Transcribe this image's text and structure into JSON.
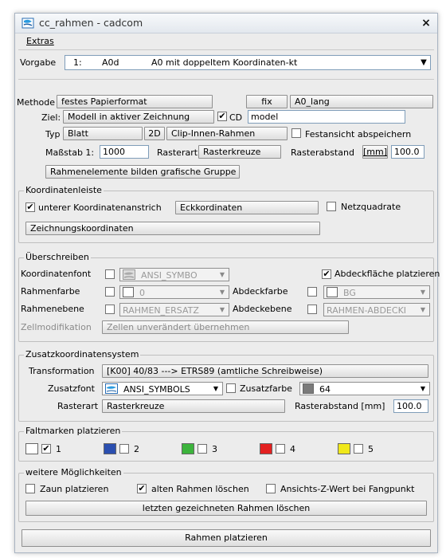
{
  "window": {
    "title": "cc_rahmen - cadcom",
    "close_glyph": "×"
  },
  "menu": {
    "extras": "Extras"
  },
  "vorgabe": {
    "label": "Vorgabe",
    "num": "1:",
    "code": "A0d",
    "desc": "A0 mit doppeltem Koordinaten-kt"
  },
  "methode": {
    "label": "Methode",
    "value": "festes Papierformat",
    "fix": "fix",
    "format": "A0_lang",
    "ziel_label": "Ziel:",
    "ziel_value": "Modell in aktiver Zeichnung",
    "cd_label": "CD",
    "cd_checked": "✔",
    "cd_value": "model",
    "typ_label": "Typ",
    "typ_value": "Blatt",
    "dim": "2D",
    "clip": "Clip-Innen-Rahmen",
    "festansicht_label": "Festansicht abspeichern",
    "massstab_label": "Maßstab 1:",
    "massstab_value": "1000",
    "rasterart_label": "Rasterart",
    "rasterart_value": "Rasterkreuze",
    "rasterabstand_label": "Rasterabstand",
    "unit": "[mm]",
    "rasterabstand_value": "100.0",
    "gruppe_btn": "Rahmenelemente bilden grafische Gruppe"
  },
  "koordinatenleiste": {
    "title": "Koordinatenleiste",
    "unterer_label": "unterer Koordinatenanstrich",
    "unterer_checked": "✔",
    "eck_btn": "Eckkordinaten",
    "netz_label": "Netzquadrate",
    "zeichnung_btn": "Zeichnungskoordinaten"
  },
  "ueberschreiben": {
    "title": "Überschreiben",
    "kfont_label": "Koordinatenfont",
    "kfont_value": "ANSI_SYMBO",
    "abdeckflaeche_label": "Abdeckfläche platzieren",
    "abdeckflaeche_checked": "✔",
    "rfarbe_label": "Rahmenfarbe",
    "rfarbe_value": "0",
    "afarbe_label": "Abdeckfarbe",
    "afarbe_value": "BG",
    "rebene_label": "Rahmenebene",
    "rebene_value": "RAHMEN_ERSATZ",
    "aebene_label": "Abdeckebene",
    "aebene_value": "RAHMEN-ABDECKI",
    "zell_label": "Zellmodifikation",
    "zell_value": "Zellen unverändert übernehmen"
  },
  "zusatz": {
    "title": "Zusatzkoordinatensystem",
    "trans_label": "Transformation",
    "trans_value": "[K00] 40/83 ---> ETRS89  (amtliche Schreibweise)",
    "font_label": "Zusatzfont",
    "font_value": "ANSI_SYMBOLS",
    "farbe_label": "Zusatzfarbe",
    "farbe_value": "64",
    "rasterart_label": "Rasterart",
    "rasterart_value": "Rasterkreuze",
    "rasterabstand_label": "Rasterabstand [mm]",
    "rasterabstand_value": "100.0"
  },
  "faltmarken": {
    "title": "Faltmarken platzieren",
    "items": [
      {
        "num": "1",
        "color": "#ffffff",
        "checked": "✔"
      },
      {
        "num": "2",
        "color": "#2b4fb0",
        "checked": ""
      },
      {
        "num": "3",
        "color": "#3cb43c",
        "checked": ""
      },
      {
        "num": "4",
        "color": "#e32020",
        "checked": ""
      },
      {
        "num": "5",
        "color": "#f0e81a",
        "checked": ""
      }
    ]
  },
  "weitere": {
    "title": "weitere Möglichkeiten",
    "zaun_label": "Zaun platzieren",
    "alten_label": "alten Rahmen löschen",
    "alten_checked": "✔",
    "ansicht_label": "Ansichts-Z-Wert bei Fangpunkt",
    "loeschen_btn": "letzten gezeichneten Rahmen löschen"
  },
  "platzieren_btn": "Rahmen platzieren",
  "icons": {
    "chevron": "▼"
  }
}
